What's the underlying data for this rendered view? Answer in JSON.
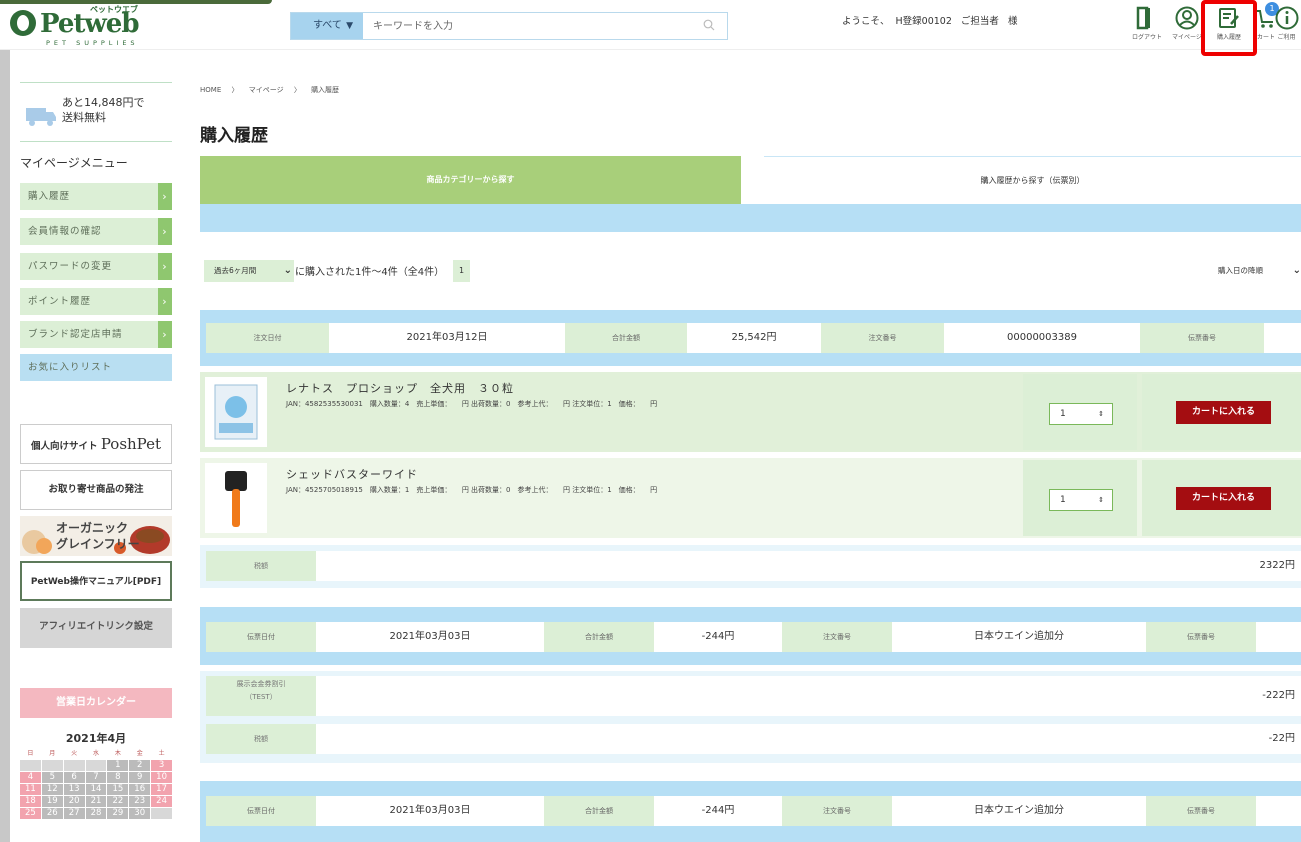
{
  "header": {
    "logo_name": "Petweb",
    "logo_kana": "ペットウエブ",
    "logo_sub": "PET SUPPLIES",
    "search_category": "すべて",
    "search_placeholder": "キーワードを入力",
    "welcome_prefix": "ようこそ、",
    "welcome_user": "H登録00102",
    "welcome_contact": "ご担当者",
    "welcome_suffix": "様",
    "icons": [
      {
        "label": "ログアウト",
        "icon": "logout-icon"
      },
      {
        "label": "マイページ",
        "icon": "user-icon"
      },
      {
        "label": "購入履歴",
        "icon": "purchase-history-icon"
      },
      {
        "label": "カート",
        "icon": "cart-icon"
      },
      {
        "label": "ご利用",
        "icon": "info-icon"
      }
    ],
    "cart_count": "1",
    "colors": {
      "brand": "#2f6b38",
      "highlight": "#ee0000",
      "cart_badge": "#3d8ee0"
    }
  },
  "sidebar": {
    "free_shipping_line1": "あと14,848円で",
    "free_shipping_line2": "送料無料",
    "menu_title": "マイページメニュー",
    "menu": [
      {
        "label": "購入履歴"
      },
      {
        "label": "会員情報の確認"
      },
      {
        "label": "パスワードの変更"
      },
      {
        "label": "ポイント履歴"
      },
      {
        "label": "ブランド認定店申請"
      },
      {
        "label": "お気に入りリスト"
      }
    ],
    "banners": {
      "posh_prefix": "個人向けサイト",
      "posh_name": "PoshPet",
      "order": "お取り寄せ商品の発注",
      "organic_line1": "オーガニック",
      "organic_line2": "グレインフリー",
      "manual": "PetWeb操作マニュアル[PDF]",
      "affiliate": "アフィリエイトリンク設定"
    },
    "calendar_title": "営業日カレンダー",
    "calendar_month": "2021年4月",
    "calendar_weekdays": [
      "日",
      "月",
      "火",
      "水",
      "木",
      "金",
      "土"
    ],
    "calendar_rows": [
      [
        "",
        "",
        "",
        "",
        "1",
        "2",
        "3"
      ],
      [
        "4",
        "5",
        "6",
        "7",
        "8",
        "9",
        "10"
      ],
      [
        "11",
        "12",
        "13",
        "14",
        "15",
        "16",
        "17"
      ],
      [
        "18",
        "19",
        "20",
        "21",
        "22",
        "23",
        "24"
      ],
      [
        "25",
        "26",
        "27",
        "28",
        "29",
        "30",
        ""
      ]
    ]
  },
  "main": {
    "breadcrumb": [
      "HOME",
      "〉",
      "マイページ",
      "〉",
      "購入履歴"
    ],
    "title": "購入履歴",
    "tab_category": "商品カテゴリーから探す",
    "tab_history": "購入履歴から探す（伝票別）",
    "period_select": "過去6ヶ月間",
    "count_text": "に購入された1件〜4件（全4件）",
    "page_number": "1",
    "sort_select": "購入日の降順",
    "orders": [
      {
        "date_label": "注文日付",
        "date": "2021年03月12日",
        "total_label": "合計金額",
        "total": "25,542円",
        "number_label": "注文番号",
        "number": "00000003389",
        "slip_label": "伝票番号",
        "items": [
          {
            "name": "レナトス　プロショップ　全犬用　３０粒",
            "detail": "JAN：4582535530031　購入数量：4　売上単価：　　円 出荷数量：0　参考上代：　　円 注文単位：1　価格：　　円",
            "qty": "1",
            "cart_label": "カートに入れる"
          },
          {
            "name": "シェッドバスターワイド",
            "detail": "JAN：4525705018915　購入数量：1　売上単価：　　円 出荷数量：0　参考上代：　　円 注文単位：1　価格：　　円",
            "qty": "1",
            "cart_label": "カートに入れる"
          }
        ],
        "tax_label": "税額",
        "tax": "2322円"
      },
      {
        "date_label": "伝票日付",
        "date": "2021年03月03日",
        "total_label": "合計金額",
        "total": "-244円",
        "number_label": "注文番号",
        "number": "日本ウエイン追加分",
        "slip_label": "伝票番号",
        "discount_label_1": "展示会金券割引",
        "discount_label_2": "（TEST）",
        "discount": "-222円",
        "tax_label": "税額",
        "tax": "-22円"
      },
      {
        "date_label": "伝票日付",
        "date": "2021年03月03日",
        "total_label": "合計金額",
        "total": "-244円",
        "number_label": "注文番号",
        "number": "日本ウエイン追加分",
        "slip_label": "伝票番号"
      }
    ]
  }
}
